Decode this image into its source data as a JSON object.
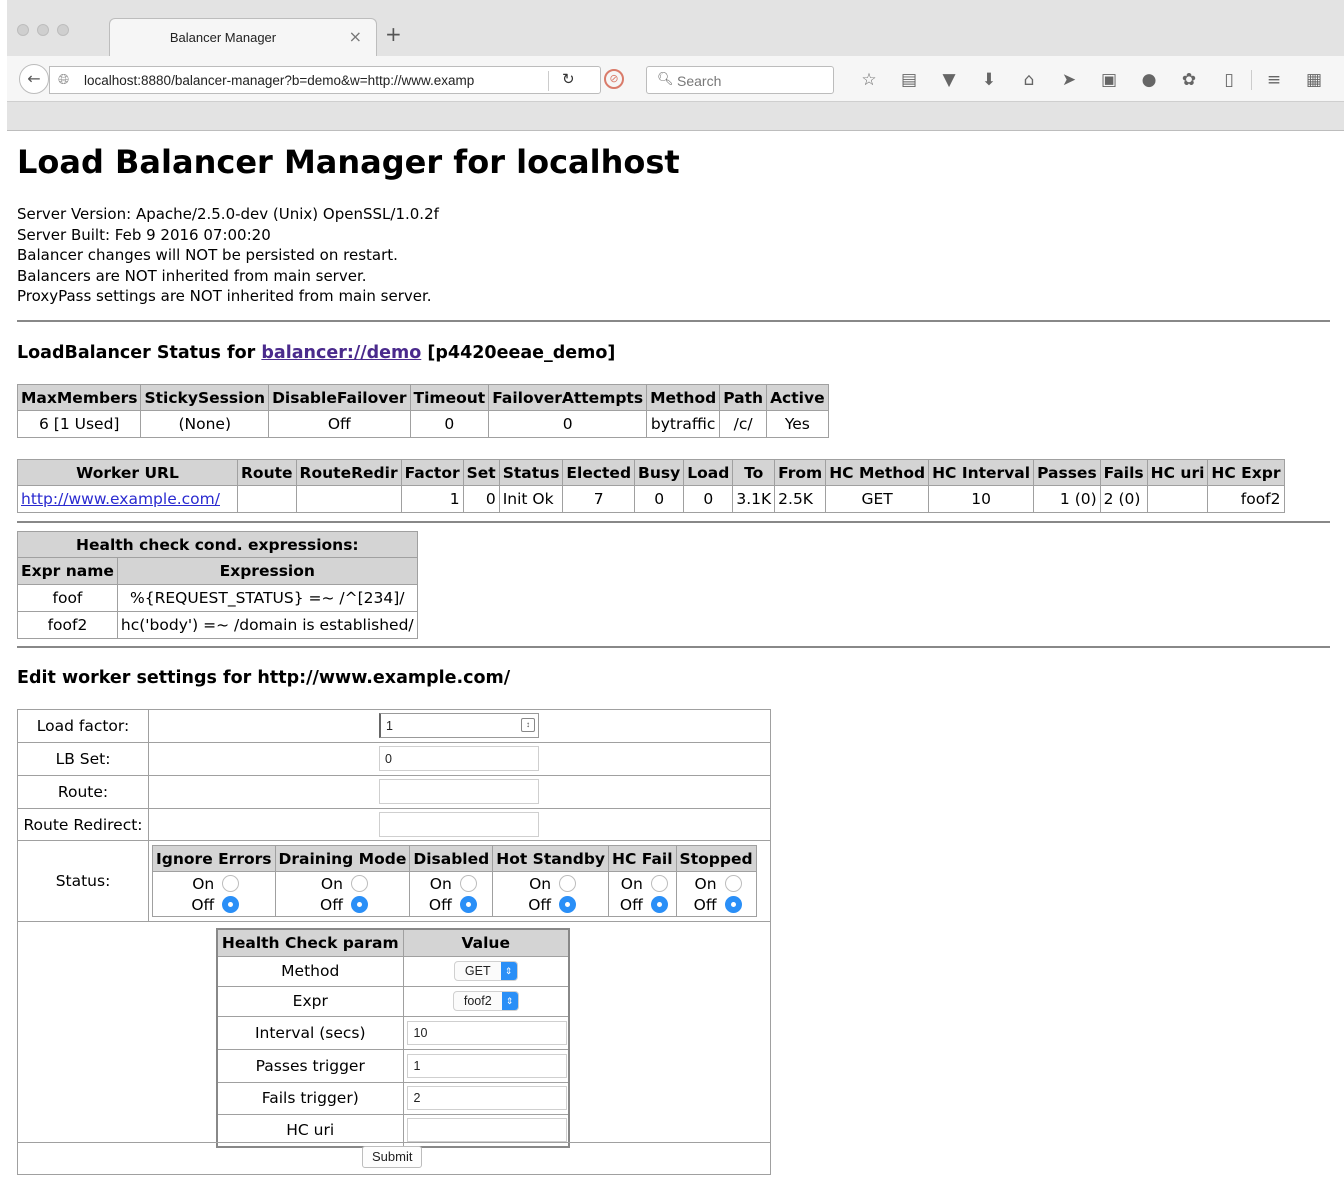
{
  "browser": {
    "tab_title": "Balancer Manager",
    "tab_close": "×",
    "new_tab": "+",
    "url": "localhost:8880/balancer-manager?b=demo&w=http://www.examp",
    "search_placeholder": "Search"
  },
  "page": {
    "title": "Load Balancer Manager for localhost",
    "info": [
      "Server Version: Apache/2.5.0-dev (Unix) OpenSSL/1.0.2f",
      "Server Built: Feb 9 2016 07:00:20",
      "Balancer changes will NOT be persisted on restart.",
      "Balancers are NOT inherited from main server.",
      "ProxyPass settings are NOT inherited from main server."
    ]
  },
  "lb_status": {
    "heading_prefix": "LoadBalancer Status for ",
    "heading_link": "balancer://demo",
    "heading_suffix": " [p4420eeae_demo]",
    "headers": [
      "MaxMembers",
      "StickySession",
      "DisableFailover",
      "Timeout",
      "FailoverAttempts",
      "Method",
      "Path",
      "Active"
    ],
    "row": [
      "6 [1 Used]",
      "(None)",
      "Off",
      "0",
      "0",
      "bytraffic",
      "/c/",
      "Yes"
    ]
  },
  "workers": {
    "headers": [
      "Worker URL",
      "Route",
      "RouteRedir",
      "Factor",
      "Set",
      "Status",
      "Elected",
      "Busy",
      "Load",
      "To",
      "From",
      "HC Method",
      "HC Interval",
      "Passes",
      "Fails",
      "HC uri",
      "HC Expr"
    ],
    "row": [
      "http://www.example.com/",
      "",
      "",
      "1",
      "0",
      "Init Ok",
      "7",
      "0",
      "0",
      "3.1K",
      "2.5K",
      "GET",
      "10",
      "1 (0)",
      "2 (0)",
      "",
      "foof2"
    ]
  },
  "hc_expr": {
    "title": "Health check cond. expressions:",
    "headers": [
      "Expr name",
      "Expression"
    ],
    "rows": [
      [
        "foof",
        "%{REQUEST_STATUS} =~ /^[234]/"
      ],
      [
        "foof2",
        "hc('body') =~ /domain is established/"
      ]
    ]
  },
  "edit": {
    "heading": "Edit worker settings for http://www.example.com/",
    "load_factor_label": "Load factor:",
    "load_factor_value": "1",
    "lb_set_label": "LB Set:",
    "lb_set_value": "0",
    "route_label": "Route:",
    "route_value": "",
    "route_redirect_label": "Route Redirect:",
    "route_redirect_value": "",
    "status_label": "Status:",
    "status_headers": [
      "Ignore Errors",
      "Draining Mode",
      "Disabled",
      "Hot Standby",
      "HC Fail",
      "Stopped"
    ],
    "on_label": "On",
    "off_label": "Off",
    "hc_headers": [
      "Health Check param",
      "Value"
    ],
    "hc_method_label": "Method",
    "hc_method_value": "GET",
    "hc_expr_label": "Expr",
    "hc_expr_value": "foof2",
    "hc_interval_label": "Interval (secs)",
    "hc_interval_value": "10",
    "hc_passes_label": "Passes trigger",
    "hc_passes_value": "1",
    "hc_fails_label": "Fails trigger)",
    "hc_fails_value": "2",
    "hc_uri_label": "HC uri",
    "hc_uri_value": "",
    "submit_label": "Submit"
  }
}
